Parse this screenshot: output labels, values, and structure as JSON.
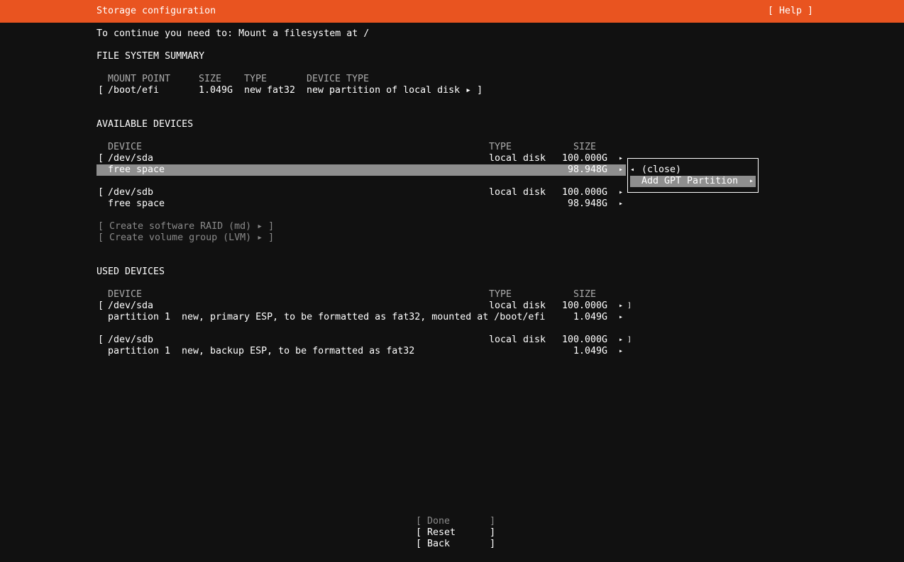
{
  "header": {
    "title": "Storage configuration",
    "help": "[ Help ]"
  },
  "instruction": "To continue you need to: Mount a filesystem at /",
  "fs_summary": {
    "heading": "FILE SYSTEM SUMMARY",
    "col_mount": "MOUNT POINT",
    "col_size": "SIZE",
    "col_type": "TYPE",
    "col_device_type": "DEVICE TYPE",
    "rows": [
      {
        "open": "[",
        "mount": "/boot/efi",
        "size": "1.049G",
        "type": "new fat32",
        "device_type": "new partition of local disk ▸ ]"
      }
    ]
  },
  "available": {
    "heading": "AVAILABLE DEVICES",
    "col_device": "DEVICE",
    "col_type": "TYPE",
    "col_size": "SIZE",
    "sda": {
      "open": "[",
      "name": "/dev/sda",
      "type": "local disk",
      "size": "100.000G",
      "arrow": "▸"
    },
    "sda_free": {
      "name": "free space",
      "size": "98.948G",
      "arrow": "▸"
    },
    "sdb": {
      "open": "[",
      "name": "/dev/sdb",
      "type": "local disk",
      "size": "100.000G",
      "arrow": "▸"
    },
    "sdb_free": {
      "name": "free space",
      "size": "98.948G",
      "arrow": "▸"
    },
    "raid": "[ Create software RAID (md) ▸ ]",
    "lvm": "[ Create volume group (LVM) ▸ ]"
  },
  "popup": {
    "close_arrow": "◂",
    "close": "(close)",
    "add_gpt": "Add GPT Partition",
    "add_arrow": "▸"
  },
  "used": {
    "heading": "USED DEVICES",
    "col_device": "DEVICE",
    "col_type": "TYPE",
    "col_size": "SIZE",
    "sda": {
      "open": "[",
      "name": "/dev/sda",
      "type": "local disk",
      "size": "100.000G",
      "arrow": "▸ ]"
    },
    "sda_p1": {
      "name": "partition 1",
      "desc": "new, primary ESP, to be formatted as fat32, mounted at /boot/efi",
      "size": "1.049G",
      "arrow": "▸"
    },
    "sdb": {
      "open": "[",
      "name": "/dev/sdb",
      "type": "local disk",
      "size": "100.000G",
      "arrow": "▸ ]"
    },
    "sdb_p1": {
      "name": "partition 1",
      "desc": "new, backup ESP, to be formatted as fat32",
      "size": "1.049G",
      "arrow": "▸"
    }
  },
  "buttons": {
    "done": "[ Done       ]",
    "reset": "[ Reset      ]",
    "back": "[ Back       ]"
  },
  "colors": {
    "accent": "#E95420",
    "background": "#111111",
    "selection": "#8e8e8e"
  }
}
